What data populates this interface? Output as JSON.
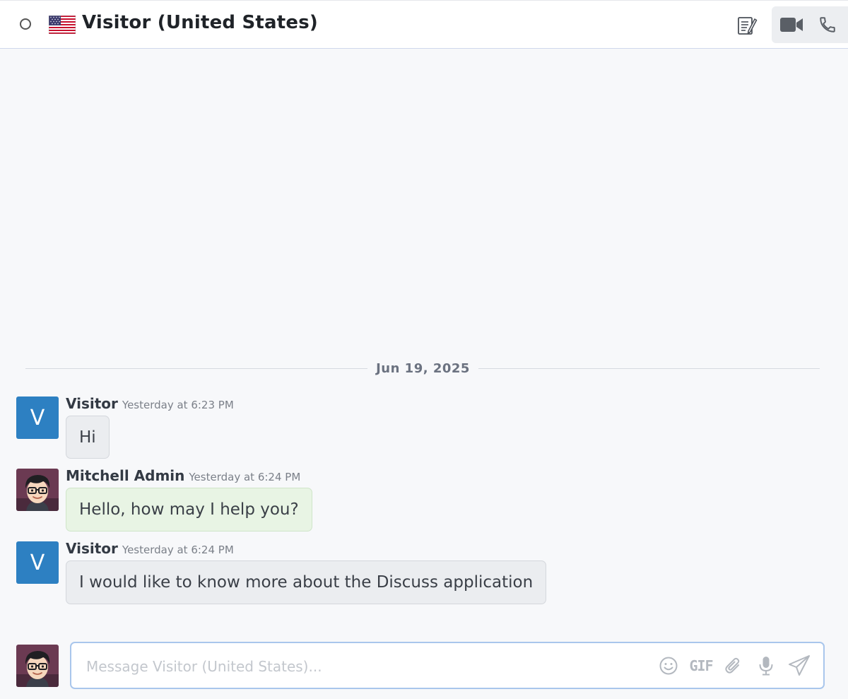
{
  "header": {
    "title": "Visitor (United States)",
    "status": "offline",
    "flag": "us-flag-icon",
    "actions": {
      "notes_icon": "notes-icon",
      "video_icon": "video-camera-icon",
      "phone_icon": "phone-icon"
    }
  },
  "thread": {
    "date_separator": "Jun 19, 2025",
    "messages": [
      {
        "author": "Visitor",
        "time": "Yesterday at 6:23 PM",
        "text": "Hi",
        "avatar_letter": "V",
        "kind": "visitor"
      },
      {
        "author": "Mitchell Admin",
        "time": "Yesterday at 6:24 PM",
        "text": "Hello, how may I help you?",
        "kind": "admin"
      },
      {
        "author": "Visitor",
        "time": "Yesterday at 6:24 PM",
        "text": "I would like to know more about the Discuss application",
        "avatar_letter": "V",
        "kind": "visitor"
      }
    ]
  },
  "composer": {
    "placeholder": "Message Visitor (United States)...",
    "value": "",
    "gif_label": "GIF",
    "icons": [
      "emoji-icon",
      "gif-icon",
      "paperclip-icon",
      "microphone-icon",
      "send-icon"
    ]
  },
  "colors": {
    "visitor_avatar": "#2d80c2",
    "admin_bubble": "#e8f4e4",
    "visitor_bubble": "#ebedf0",
    "composer_border": "#a9c6ec"
  }
}
